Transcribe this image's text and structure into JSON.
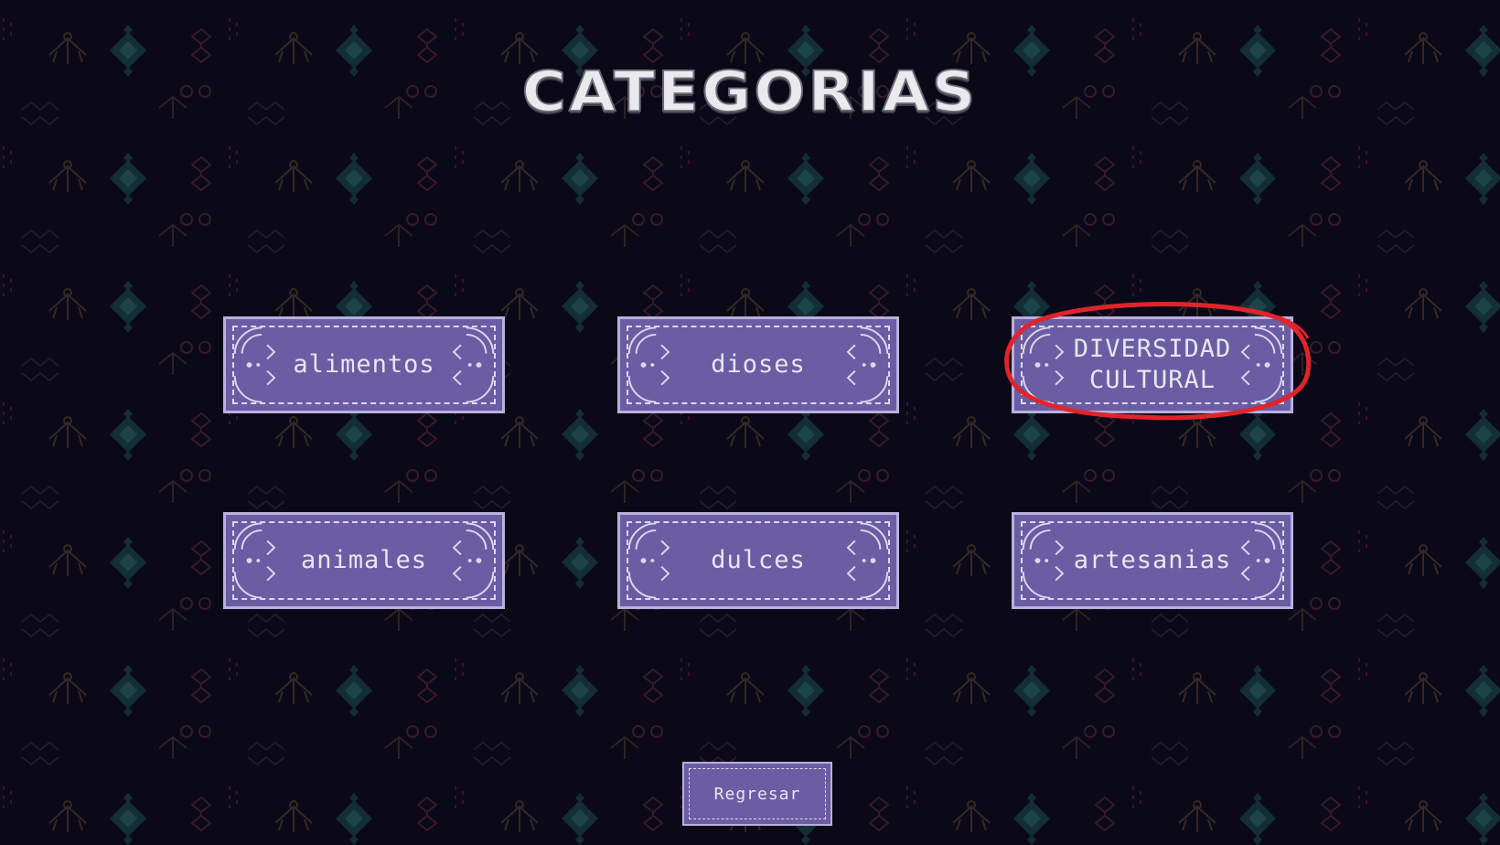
{
  "screen": {
    "title": "CATEGORIAS",
    "background_color": "#0b0818",
    "accent_color": "#6a5da3",
    "highlight_color": "#e0242c"
  },
  "categories": [
    {
      "label": "alimentos"
    },
    {
      "label": "dioses"
    },
    {
      "label": "DIVERSIDAD\nCULTURAL",
      "highlighted": true
    },
    {
      "label": "animales"
    },
    {
      "label": "dulces"
    },
    {
      "label": "artesanias"
    }
  ],
  "back_button": {
    "label": "Regresar"
  }
}
